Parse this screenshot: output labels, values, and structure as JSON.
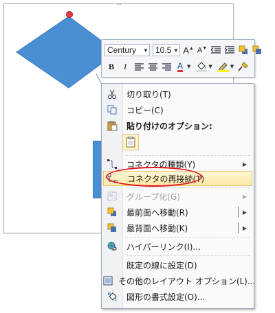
{
  "toolbar": {
    "font_name": "Century",
    "font_size": "10.5"
  },
  "menu": {
    "cut": "切り取り(T)",
    "copy": "コピー(C)",
    "paste_options": "貼り付けのオプション:",
    "connector_type": "コネクタの種類(Y)",
    "reroute_connectors": "コネクタの再接続(T)",
    "group": "グループ化(G)",
    "bring_to_front": "最前面へ移動(R)",
    "send_to_back": "最背面へ移動(K)",
    "hyperlink": "ハイパーリンク(I)...",
    "set_default_line": "既定の線に設定(D)",
    "more_layout_options": "その他のレイアウト オプション(L)...",
    "format_shape": "図形の書式設定(O)..."
  },
  "colors": {
    "shape_fill": "#4a8ed3",
    "highlight_ellipse": "#e0141e",
    "menu_hover": "#ffe9a8",
    "font_color_bar": "#e03030",
    "highlight_color_bar": "#ffff00"
  }
}
